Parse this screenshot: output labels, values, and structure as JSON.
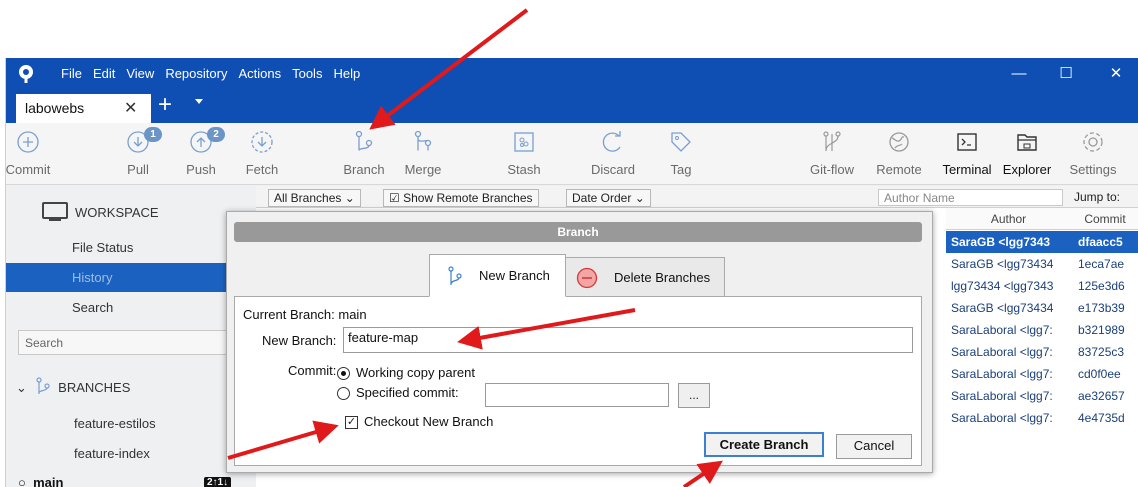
{
  "app": {
    "menu": [
      "File",
      "Edit",
      "View",
      "Repository",
      "Actions",
      "Tools",
      "Help"
    ],
    "window_controls": {
      "minimize": "—",
      "maximize": "☐",
      "close": "✕"
    }
  },
  "tabs": {
    "repo_name": "labowebs",
    "close_glyph": "✕",
    "add_glyph": "+"
  },
  "toolbar": {
    "commit": "Commit",
    "pull": "Pull",
    "pull_badge": "1",
    "push": "Push",
    "push_badge": "2",
    "fetch": "Fetch",
    "branch": "Branch",
    "merge": "Merge",
    "stash": "Stash",
    "discard": "Discard",
    "tag": "Tag",
    "gitflow": "Git-flow",
    "remote": "Remote",
    "terminal": "Terminal",
    "explorer": "Explorer",
    "settings": "Settings"
  },
  "sidebar": {
    "workspace": "WORKSPACE",
    "file_status": "File Status",
    "history": "History",
    "search": "Search",
    "search_placeholder": "Search",
    "branches_header": "BRANCHES",
    "branches": [
      "feature-estilos",
      "feature-index"
    ],
    "current_branch": "main",
    "ahead_behind": "2↑1↓"
  },
  "log": {
    "all_branches": "All Branches ⌄",
    "show_remote": "Show Remote Branches",
    "date_order": "Date Order ⌄",
    "author_placeholder": "Author Name",
    "jump_to": "Jump to:",
    "author_header": "Author",
    "commit_header": "Commit",
    "rows": [
      {
        "author": "SaraGB <lgg7343",
        "commit": "dfaacc5"
      },
      {
        "author": "SaraGB <lgg73434",
        "commit": "1eca7ae"
      },
      {
        "author": "lgg73434 <lgg7343",
        "commit": "125e3d6"
      },
      {
        "author": "SaraGB <lgg73434",
        "commit": "e173b39"
      },
      {
        "author": "SaraLaboral <lgg7:",
        "commit": "b321989"
      },
      {
        "author": "SaraLaboral <lgg7:",
        "commit": "83725c3"
      },
      {
        "author": "SaraLaboral <lgg7:",
        "commit": "cd0f0ee"
      },
      {
        "author": "SaraLaboral <lgg7:",
        "commit": "ae32657"
      },
      {
        "author": "SaraLaboral <lgg7:",
        "commit": "4e4735d"
      }
    ]
  },
  "dialog": {
    "title": "Branch",
    "tab_new": "New Branch",
    "tab_delete": "Delete Branches",
    "current_branch_label": "Current Branch: main",
    "new_branch_label": "New Branch:",
    "new_branch_value": "feature-map",
    "commit_label": "Commit:",
    "working_copy": "Working copy parent",
    "specified_commit": "Specified commit:",
    "ellipsis": "...",
    "checkout": "Checkout New Branch",
    "checkout_mark": "✓",
    "create": "Create Branch",
    "cancel": "Cancel"
  },
  "colors": {
    "title_bar": "#0f4eb3",
    "selection": "#1b62c0",
    "annotation_arrow": "#e0191b"
  }
}
